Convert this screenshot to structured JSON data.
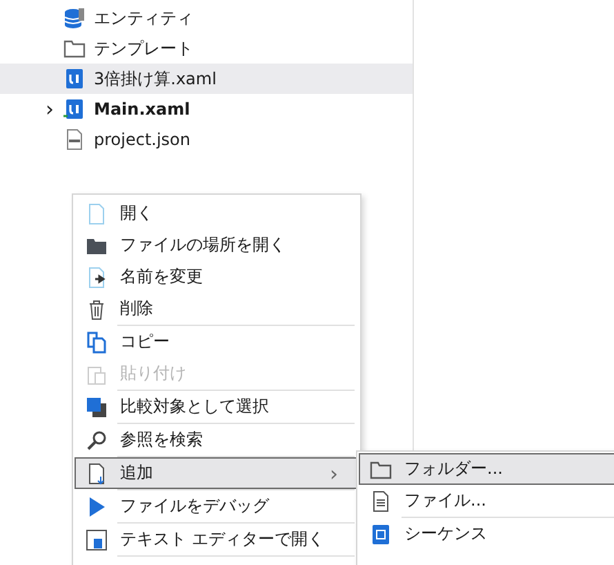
{
  "tree": [
    {
      "label": "エンティティ",
      "selected": false,
      "bold": false
    },
    {
      "label": "テンプレート",
      "selected": false,
      "bold": false
    },
    {
      "label": "3倍掛け算.xaml",
      "selected": true,
      "bold": false
    },
    {
      "label": "Main.xaml",
      "selected": false,
      "bold": true,
      "expander": "›"
    },
    {
      "label": "project.json",
      "selected": false,
      "bold": false
    }
  ],
  "context_menu": [
    {
      "kind": "item",
      "label": "開く",
      "disabled": false,
      "highlighted": false
    },
    {
      "kind": "item",
      "label": "ファイルの場所を開く",
      "disabled": false,
      "highlighted": false
    },
    {
      "kind": "item",
      "label": "名前を変更",
      "disabled": false,
      "highlighted": false
    },
    {
      "kind": "item",
      "label": "削除",
      "disabled": false,
      "highlighted": false
    },
    {
      "kind": "separator"
    },
    {
      "kind": "item",
      "label": "コピー",
      "disabled": false,
      "highlighted": false
    },
    {
      "kind": "item",
      "label": "貼り付け",
      "disabled": true,
      "highlighted": false
    },
    {
      "kind": "separator"
    },
    {
      "kind": "item",
      "label": "比較対象として選択",
      "disabled": false,
      "highlighted": false
    },
    {
      "kind": "separator"
    },
    {
      "kind": "item",
      "label": "参照を検索",
      "disabled": false,
      "highlighted": false
    },
    {
      "kind": "separator"
    },
    {
      "kind": "item",
      "label": "追加",
      "disabled": false,
      "highlighted": true,
      "submenu_arrow": "›"
    },
    {
      "kind": "separator"
    },
    {
      "kind": "item",
      "label": "ファイルをデバッグ",
      "disabled": false,
      "highlighted": false
    },
    {
      "kind": "separator"
    },
    {
      "kind": "item",
      "label": "テキスト エディターで開く",
      "disabled": false,
      "highlighted": false
    },
    {
      "kind": "separator"
    }
  ],
  "submenu": [
    {
      "kind": "item",
      "label": "フォルダー...",
      "highlighted": true
    },
    {
      "kind": "item",
      "label": "ファイル...",
      "highlighted": false
    },
    {
      "kind": "separator"
    },
    {
      "kind": "item",
      "label": "シーケンス",
      "highlighted": false
    }
  ]
}
